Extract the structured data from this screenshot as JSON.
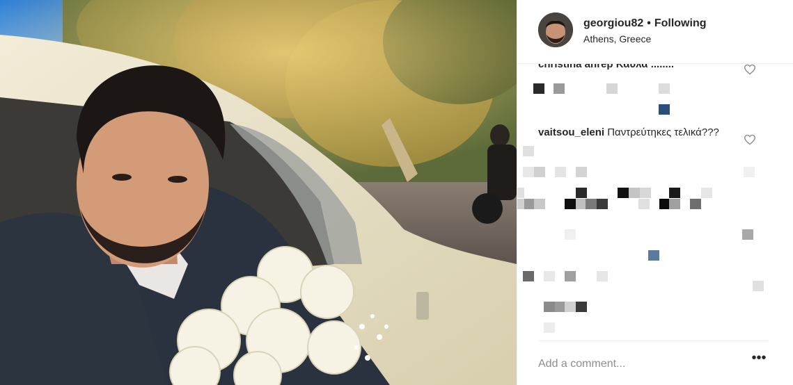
{
  "header": {
    "username": "georgiou82",
    "separator": "•",
    "follow_label": "Following",
    "location": "Athens, Greece"
  },
  "comments": {
    "clipped_text": "christina ahrep Καυλά ........",
    "items": [
      {
        "username": "vaitsou_eleni",
        "text": "Παντρεύτηκες τελικά???"
      }
    ]
  },
  "composer": {
    "placeholder": "Add a comment...",
    "more_label": "•••"
  },
  "colors": {
    "text": "#262626",
    "muted": "#8e8e8e",
    "divider": "#efefef"
  },
  "icons": {
    "like": "heart-icon",
    "more": "ellipsis-icon"
  }
}
